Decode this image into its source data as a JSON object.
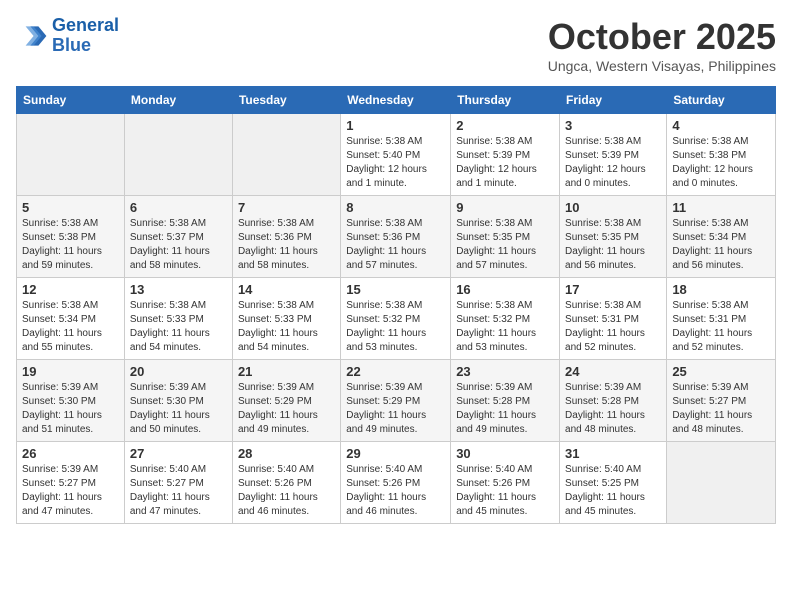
{
  "header": {
    "logo_line1": "General",
    "logo_line2": "Blue",
    "month": "October 2025",
    "location": "Ungca, Western Visayas, Philippines"
  },
  "weekdays": [
    "Sunday",
    "Monday",
    "Tuesday",
    "Wednesday",
    "Thursday",
    "Friday",
    "Saturday"
  ],
  "weeks": [
    [
      {
        "day": "",
        "empty": true
      },
      {
        "day": "",
        "empty": true
      },
      {
        "day": "",
        "empty": true
      },
      {
        "day": "1",
        "sunrise": "5:38 AM",
        "sunset": "5:40 PM",
        "daylight": "12 hours and 1 minute."
      },
      {
        "day": "2",
        "sunrise": "5:38 AM",
        "sunset": "5:39 PM",
        "daylight": "12 hours and 1 minute."
      },
      {
        "day": "3",
        "sunrise": "5:38 AM",
        "sunset": "5:39 PM",
        "daylight": "12 hours and 0 minutes."
      },
      {
        "day": "4",
        "sunrise": "5:38 AM",
        "sunset": "5:38 PM",
        "daylight": "12 hours and 0 minutes."
      }
    ],
    [
      {
        "day": "5",
        "sunrise": "5:38 AM",
        "sunset": "5:38 PM",
        "daylight": "11 hours and 59 minutes."
      },
      {
        "day": "6",
        "sunrise": "5:38 AM",
        "sunset": "5:37 PM",
        "daylight": "11 hours and 58 minutes."
      },
      {
        "day": "7",
        "sunrise": "5:38 AM",
        "sunset": "5:36 PM",
        "daylight": "11 hours and 58 minutes."
      },
      {
        "day": "8",
        "sunrise": "5:38 AM",
        "sunset": "5:36 PM",
        "daylight": "11 hours and 57 minutes."
      },
      {
        "day": "9",
        "sunrise": "5:38 AM",
        "sunset": "5:35 PM",
        "daylight": "11 hours and 57 minutes."
      },
      {
        "day": "10",
        "sunrise": "5:38 AM",
        "sunset": "5:35 PM",
        "daylight": "11 hours and 56 minutes."
      },
      {
        "day": "11",
        "sunrise": "5:38 AM",
        "sunset": "5:34 PM",
        "daylight": "11 hours and 56 minutes."
      }
    ],
    [
      {
        "day": "12",
        "sunrise": "5:38 AM",
        "sunset": "5:34 PM",
        "daylight": "11 hours and 55 minutes."
      },
      {
        "day": "13",
        "sunrise": "5:38 AM",
        "sunset": "5:33 PM",
        "daylight": "11 hours and 54 minutes."
      },
      {
        "day": "14",
        "sunrise": "5:38 AM",
        "sunset": "5:33 PM",
        "daylight": "11 hours and 54 minutes."
      },
      {
        "day": "15",
        "sunrise": "5:38 AM",
        "sunset": "5:32 PM",
        "daylight": "11 hours and 53 minutes."
      },
      {
        "day": "16",
        "sunrise": "5:38 AM",
        "sunset": "5:32 PM",
        "daylight": "11 hours and 53 minutes."
      },
      {
        "day": "17",
        "sunrise": "5:38 AM",
        "sunset": "5:31 PM",
        "daylight": "11 hours and 52 minutes."
      },
      {
        "day": "18",
        "sunrise": "5:38 AM",
        "sunset": "5:31 PM",
        "daylight": "11 hours and 52 minutes."
      }
    ],
    [
      {
        "day": "19",
        "sunrise": "5:39 AM",
        "sunset": "5:30 PM",
        "daylight": "11 hours and 51 minutes."
      },
      {
        "day": "20",
        "sunrise": "5:39 AM",
        "sunset": "5:30 PM",
        "daylight": "11 hours and 50 minutes."
      },
      {
        "day": "21",
        "sunrise": "5:39 AM",
        "sunset": "5:29 PM",
        "daylight": "11 hours and 49 minutes."
      },
      {
        "day": "22",
        "sunrise": "5:39 AM",
        "sunset": "5:29 PM",
        "daylight": "11 hours and 49 minutes."
      },
      {
        "day": "23",
        "sunrise": "5:39 AM",
        "sunset": "5:28 PM",
        "daylight": "11 hours and 49 minutes."
      },
      {
        "day": "24",
        "sunrise": "5:39 AM",
        "sunset": "5:28 PM",
        "daylight": "11 hours and 48 minutes."
      },
      {
        "day": "25",
        "sunrise": "5:39 AM",
        "sunset": "5:27 PM",
        "daylight": "11 hours and 48 minutes."
      }
    ],
    [
      {
        "day": "26",
        "sunrise": "5:39 AM",
        "sunset": "5:27 PM",
        "daylight": "11 hours and 47 minutes."
      },
      {
        "day": "27",
        "sunrise": "5:40 AM",
        "sunset": "5:27 PM",
        "daylight": "11 hours and 47 minutes."
      },
      {
        "day": "28",
        "sunrise": "5:40 AM",
        "sunset": "5:26 PM",
        "daylight": "11 hours and 46 minutes."
      },
      {
        "day": "29",
        "sunrise": "5:40 AM",
        "sunset": "5:26 PM",
        "daylight": "11 hours and 46 minutes."
      },
      {
        "day": "30",
        "sunrise": "5:40 AM",
        "sunset": "5:26 PM",
        "daylight": "11 hours and 45 minutes."
      },
      {
        "day": "31",
        "sunrise": "5:40 AM",
        "sunset": "5:25 PM",
        "daylight": "11 hours and 45 minutes."
      },
      {
        "day": "",
        "empty": true
      }
    ]
  ]
}
